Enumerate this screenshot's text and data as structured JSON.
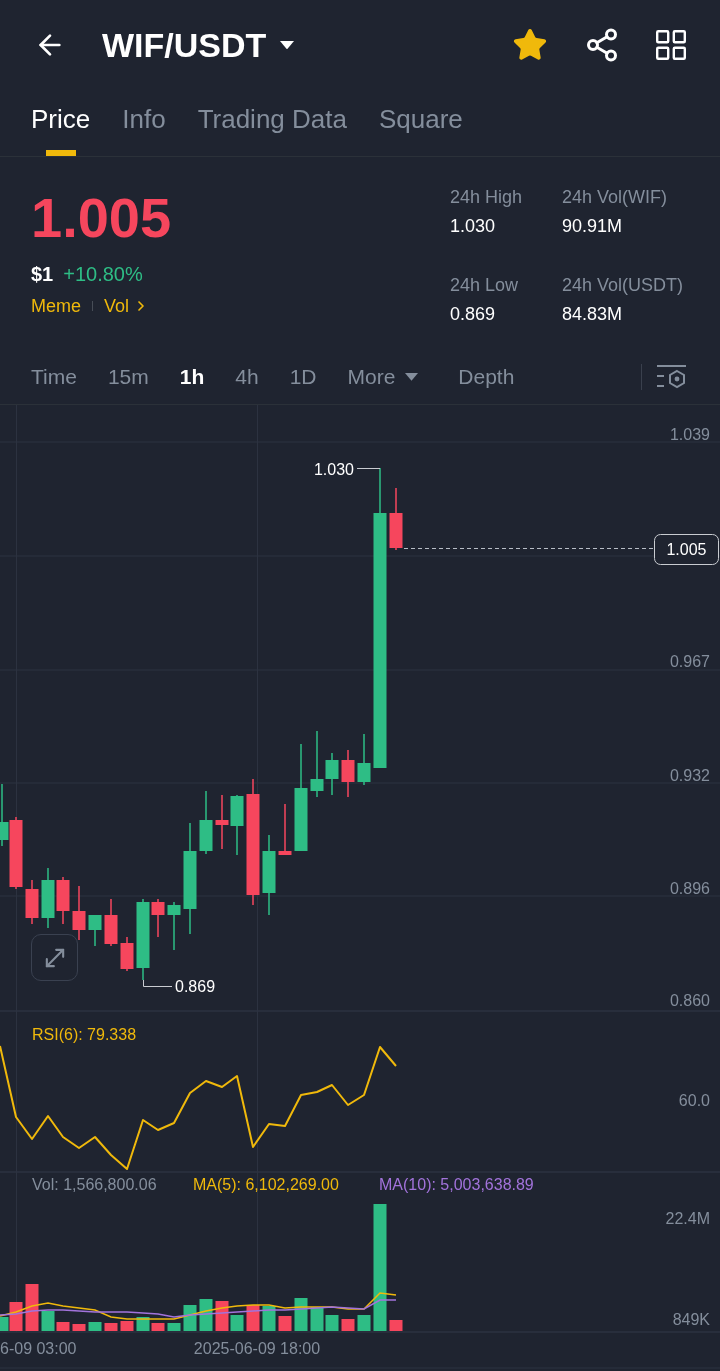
{
  "header": {
    "title": "WIF/USDT",
    "favorited": true
  },
  "tabs": [
    {
      "label": "Price",
      "selected": true
    },
    {
      "label": "Info",
      "selected": false
    },
    {
      "label": "Trading Data",
      "selected": false
    },
    {
      "label": "Square",
      "selected": false
    }
  ],
  "price": {
    "last": "1.005",
    "last_rising": false,
    "usd": "$1",
    "change": "+10.80%",
    "change_rising": true,
    "tags": [
      {
        "label": "Meme",
        "kind": "tag"
      },
      {
        "label": "Vol",
        "kind": "link"
      }
    ]
  },
  "stats": [
    {
      "label": "24h High",
      "value": "1.030"
    },
    {
      "label": "24h Vol(WIF)",
      "value": "90.91M"
    },
    {
      "label": "24h Low",
      "value": "0.869"
    },
    {
      "label": "24h Vol(USDT)",
      "value": "84.83M"
    }
  ],
  "intervals": [
    {
      "label": "Time",
      "kind": "interval",
      "selected": false
    },
    {
      "label": "15m",
      "kind": "interval",
      "selected": false
    },
    {
      "label": "1h",
      "kind": "interval",
      "selected": true
    },
    {
      "label": "4h",
      "kind": "interval",
      "selected": false
    },
    {
      "label": "1D",
      "kind": "interval",
      "selected": false
    },
    {
      "label": "More",
      "kind": "dropdown",
      "selected": false
    },
    {
      "label": "Depth",
      "kind": "view",
      "selected": false
    }
  ],
  "chart": {
    "price_ticks": [
      "1.039",
      "0.967",
      "0.932",
      "0.896",
      "0.860"
    ],
    "current_price": "1.005",
    "high_marker": "1.030",
    "low_marker": "0.869"
  },
  "rsi": {
    "label": "RSI(6): 79.338",
    "ticks": [
      "60.0"
    ]
  },
  "volume": {
    "vol": "Vol: 1,566,800.06",
    "ma5": "MA(5): 6,102,269.00",
    "ma10": "MA(10): 5,003,638.89",
    "ticks": [
      "22.4M",
      "849K"
    ]
  },
  "time_axis": [
    "6-09 03:00",
    "2025-06-09 18:00"
  ]
}
